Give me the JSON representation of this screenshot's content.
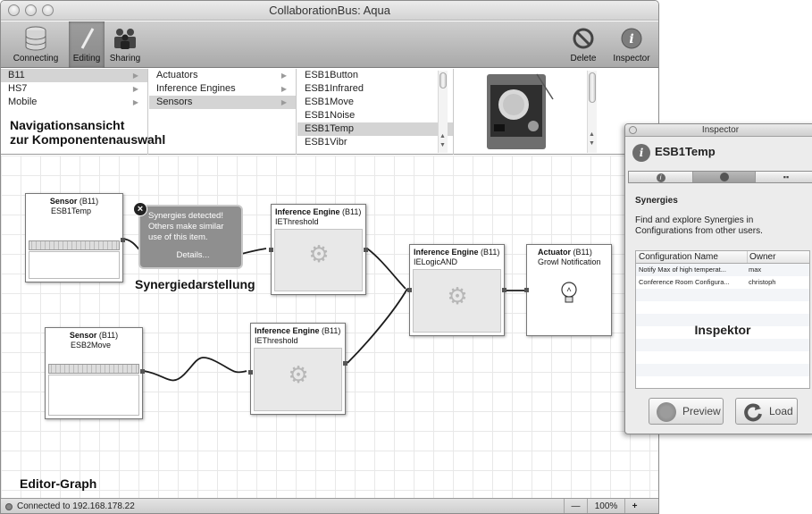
{
  "window": {
    "title": "CollaborationBus: Aqua"
  },
  "toolbar": {
    "connecting": "Connecting",
    "editing": "Editing",
    "sharing": "Sharing",
    "delete": "Delete",
    "inspector": "Inspector"
  },
  "browser": {
    "col1": [
      "B11",
      "HS7",
      "Mobile"
    ],
    "col2": [
      "Actuators",
      "Inference Engines",
      "Sensors"
    ],
    "col3": [
      "ESB1Button",
      "ESB1Infrared",
      "ESB1Move",
      "ESB1Noise",
      "ESB1Temp",
      "ESB1Vibr"
    ],
    "selected": {
      "col1": "B11",
      "col2": "Sensors",
      "col3": "ESB1Temp"
    }
  },
  "annotations": {
    "nav_line1": "Navigationsansicht",
    "nav_line2": "zur Komponentenauswahl",
    "synergy": "Synergiedarstellung",
    "editor": "Editor-Graph",
    "inspector": "Inspektor"
  },
  "graph": {
    "sensor1": {
      "type": "Sensor",
      "loc": "(B11)",
      "name": "ESB1Temp"
    },
    "sensor2": {
      "type": "Sensor",
      "loc": "(B11)",
      "name": "ESB2Move"
    },
    "inf1": {
      "type": "Inference Engine",
      "loc": "(B11)",
      "name": "IEThreshold"
    },
    "inf2": {
      "type": "Inference Engine",
      "loc": "(B11)",
      "name": "IEThreshold"
    },
    "inf3": {
      "type": "Inference Engine",
      "loc": "(B11)",
      "name": "IELogicAND"
    },
    "act1": {
      "type": "Actuator",
      "loc": "(B11)",
      "name": "Growl Notification"
    },
    "synergy_popup": {
      "line1": "Synergies detected!",
      "line2": "Others make similar",
      "line3": "use of this item.",
      "details": "Details..."
    }
  },
  "status": {
    "text": "Connected to 192.168.178.22",
    "zoom_out": "—",
    "zoom": "100%",
    "zoom_in": "+"
  },
  "inspector": {
    "title": "Inspector",
    "item": "ESB1Temp",
    "section": "Synergies",
    "desc_line1": "Find and explore Synergies in",
    "desc_line2": "Configurations from other users.",
    "columns": [
      "Configuration Name",
      "Owner"
    ],
    "rows": [
      {
        "name": "Notify Max of high temperat...",
        "owner": "max"
      },
      {
        "name": "Conference Room Configura...",
        "owner": "christoph"
      }
    ],
    "preview": "Preview",
    "load": "Load"
  }
}
